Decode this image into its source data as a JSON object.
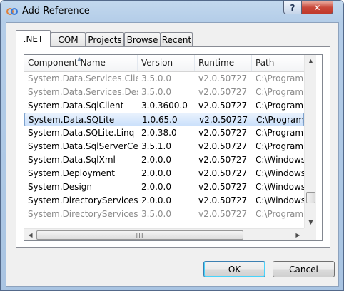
{
  "window": {
    "title": "Add Reference",
    "help_label": "?",
    "close_label": "✕"
  },
  "tabs": [
    {
      "label": ".NET",
      "active": true
    },
    {
      "label": "COM",
      "active": false
    },
    {
      "label": "Projects",
      "active": false
    },
    {
      "label": "Browse",
      "active": false
    },
    {
      "label": "Recent",
      "active": false
    }
  ],
  "columns": [
    "Component Name",
    "Version",
    "Runtime",
    "Path"
  ],
  "rows": [
    {
      "name": "System.Data.Services.Client",
      "version": "3.5.0.0",
      "runtime": "v2.0.50727",
      "path": "C:\\Program",
      "dim": true,
      "selected": false
    },
    {
      "name": "System.Data.Services.Design",
      "version": "3.5.0.0",
      "runtime": "v2.0.50727",
      "path": "C:\\Program",
      "dim": true,
      "selected": false
    },
    {
      "name": "System.Data.SqlClient",
      "version": "3.0.3600.0",
      "runtime": "v2.0.50727",
      "path": "C:\\Program",
      "dim": false,
      "selected": false
    },
    {
      "name": "System.Data.SQLite",
      "version": "1.0.65.0",
      "runtime": "v2.0.50727",
      "path": "C:\\Program",
      "dim": false,
      "selected": true
    },
    {
      "name": "System.Data.SQLite.Linq",
      "version": "2.0.38.0",
      "runtime": "v2.0.50727",
      "path": "C:\\Program",
      "dim": false,
      "selected": false
    },
    {
      "name": "System.Data.SqlServerCe",
      "version": "3.5.1.0",
      "runtime": "v2.0.50727",
      "path": "C:\\Program",
      "dim": false,
      "selected": false
    },
    {
      "name": "System.Data.SqlXml",
      "version": "2.0.0.0",
      "runtime": "v2.0.50727",
      "path": "C:\\Windows\\",
      "dim": false,
      "selected": false
    },
    {
      "name": "System.Deployment",
      "version": "2.0.0.0",
      "runtime": "v2.0.50727",
      "path": "C:\\Windows\\",
      "dim": false,
      "selected": false
    },
    {
      "name": "System.Design",
      "version": "2.0.0.0",
      "runtime": "v2.0.50727",
      "path": "C:\\Windows\\",
      "dim": false,
      "selected": false
    },
    {
      "name": "System.DirectoryServices",
      "version": "2.0.0.0",
      "runtime": "v2.0.50727",
      "path": "C:\\Windows\\",
      "dim": false,
      "selected": false
    },
    {
      "name": "System.DirectoryServices....",
      "version": "3.5.0.0",
      "runtime": "v2.0.50727",
      "path": "C:\\Program",
      "dim": true,
      "selected": false
    }
  ],
  "buttons": {
    "ok": "OK",
    "cancel": "Cancel"
  },
  "icons": {
    "app": "add-reference-icon",
    "sort": "sort-ascending-icon",
    "scroll_up": "scroll-up-icon",
    "scroll_down": "scroll-down-icon",
    "scroll_left": "scroll-left-icon",
    "scroll_right": "scroll-right-icon"
  }
}
